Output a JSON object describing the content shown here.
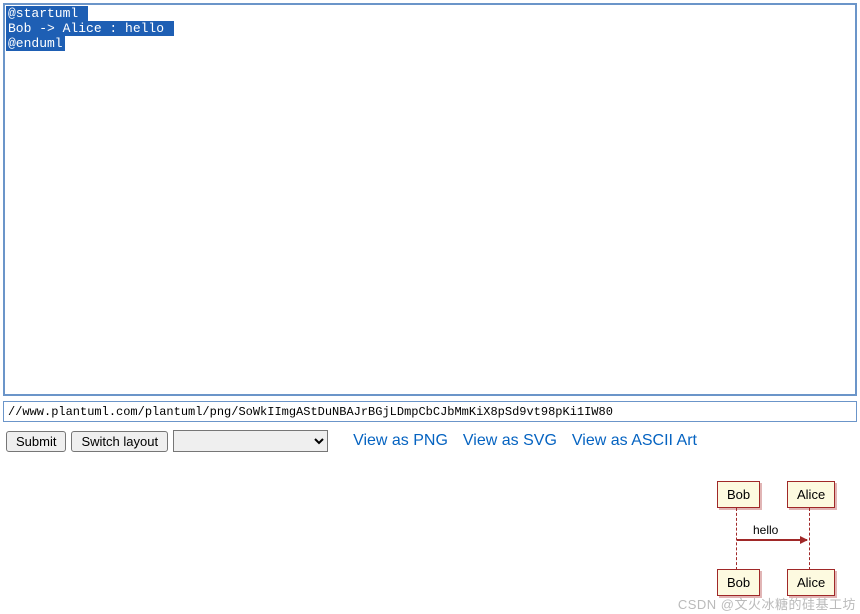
{
  "editor": {
    "lines": [
      "@startuml ",
      "Bob -> Alice : hello ",
      "@enduml"
    ]
  },
  "url_input": {
    "value": "//www.plantuml.com/plantuml/png/SoWkIImgAStDuNBAJrBGjLDmpCbCJbMmKiX8pSd9vt98pKi1IW80"
  },
  "toolbar": {
    "submit_label": "Submit",
    "switch_label": "Switch layout",
    "links": {
      "png": "View as PNG",
      "svg": "View as SVG",
      "ascii": "View as ASCII Art"
    }
  },
  "diagram": {
    "actor_a": "Bob",
    "actor_b": "Alice",
    "message": "hello"
  },
  "watermark": "CSDN @文火冰糖的硅基工坊"
}
